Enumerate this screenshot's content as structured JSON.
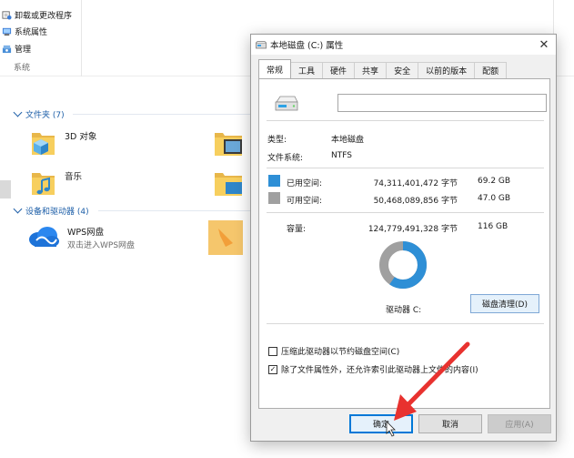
{
  "ribbon": {
    "items": [
      {
        "label": "卸载或更改程序",
        "icon": "uninstall-icon"
      },
      {
        "label": "系统属性",
        "icon": "system-properties-icon"
      },
      {
        "label": "管理",
        "icon": "manage-icon"
      }
    ],
    "group_label": "系统"
  },
  "sections": {
    "folders": {
      "label": "文件夹 (7)"
    },
    "devices": {
      "label": "设备和驱动器 (4)"
    }
  },
  "folders": [
    {
      "label": "3D 对象",
      "icon": "3d-objects-folder-icon"
    },
    {
      "label": "音乐",
      "icon": "music-folder-icon"
    }
  ],
  "devices": [
    {
      "name": "WPS网盘",
      "subtitle": "双击进入WPS网盘",
      "icon": "wps-cloud-icon"
    }
  ],
  "dialog": {
    "title": "本地磁盘 (C:) 属性",
    "close_glyph": "✕",
    "tabs": [
      {
        "label": "常规",
        "active": true
      },
      {
        "label": "工具"
      },
      {
        "label": "硬件"
      },
      {
        "label": "共享"
      },
      {
        "label": "安全"
      },
      {
        "label": "以前的版本"
      },
      {
        "label": "配额"
      }
    ],
    "volume_name_value": "",
    "type_label": "类型:",
    "type_value": "本地磁盘",
    "fs_label": "文件系统:",
    "fs_value": "NTFS",
    "used": {
      "label": "已用空间:",
      "bytes": "74,311,401,472 字节",
      "size": "69.2 GB",
      "color": "#2e8fd6"
    },
    "free": {
      "label": "可用空间:",
      "bytes": "50,468,089,856 字节",
      "size": "47.0 GB",
      "color": "#a0a0a0"
    },
    "capacity": {
      "label": "容量:",
      "bytes": "124,779,491,328 字节",
      "size": "116 GB"
    },
    "used_fraction": 0.596,
    "drive_label": "驱动器 C:",
    "cleanup_button": "磁盘清理(D)",
    "compress_option": {
      "label": "压缩此驱动器以节约磁盘空间(C)",
      "checked": false
    },
    "index_option": {
      "label": "除了文件属性外，还允许索引此驱动器上文件的内容(I)",
      "checked": true
    },
    "ok_button": "确定",
    "cancel_button": "取消",
    "apply_button": "应用(A)"
  },
  "colors": {
    "accent": "#0078d7",
    "annotation_arrow": "#e8322f"
  }
}
